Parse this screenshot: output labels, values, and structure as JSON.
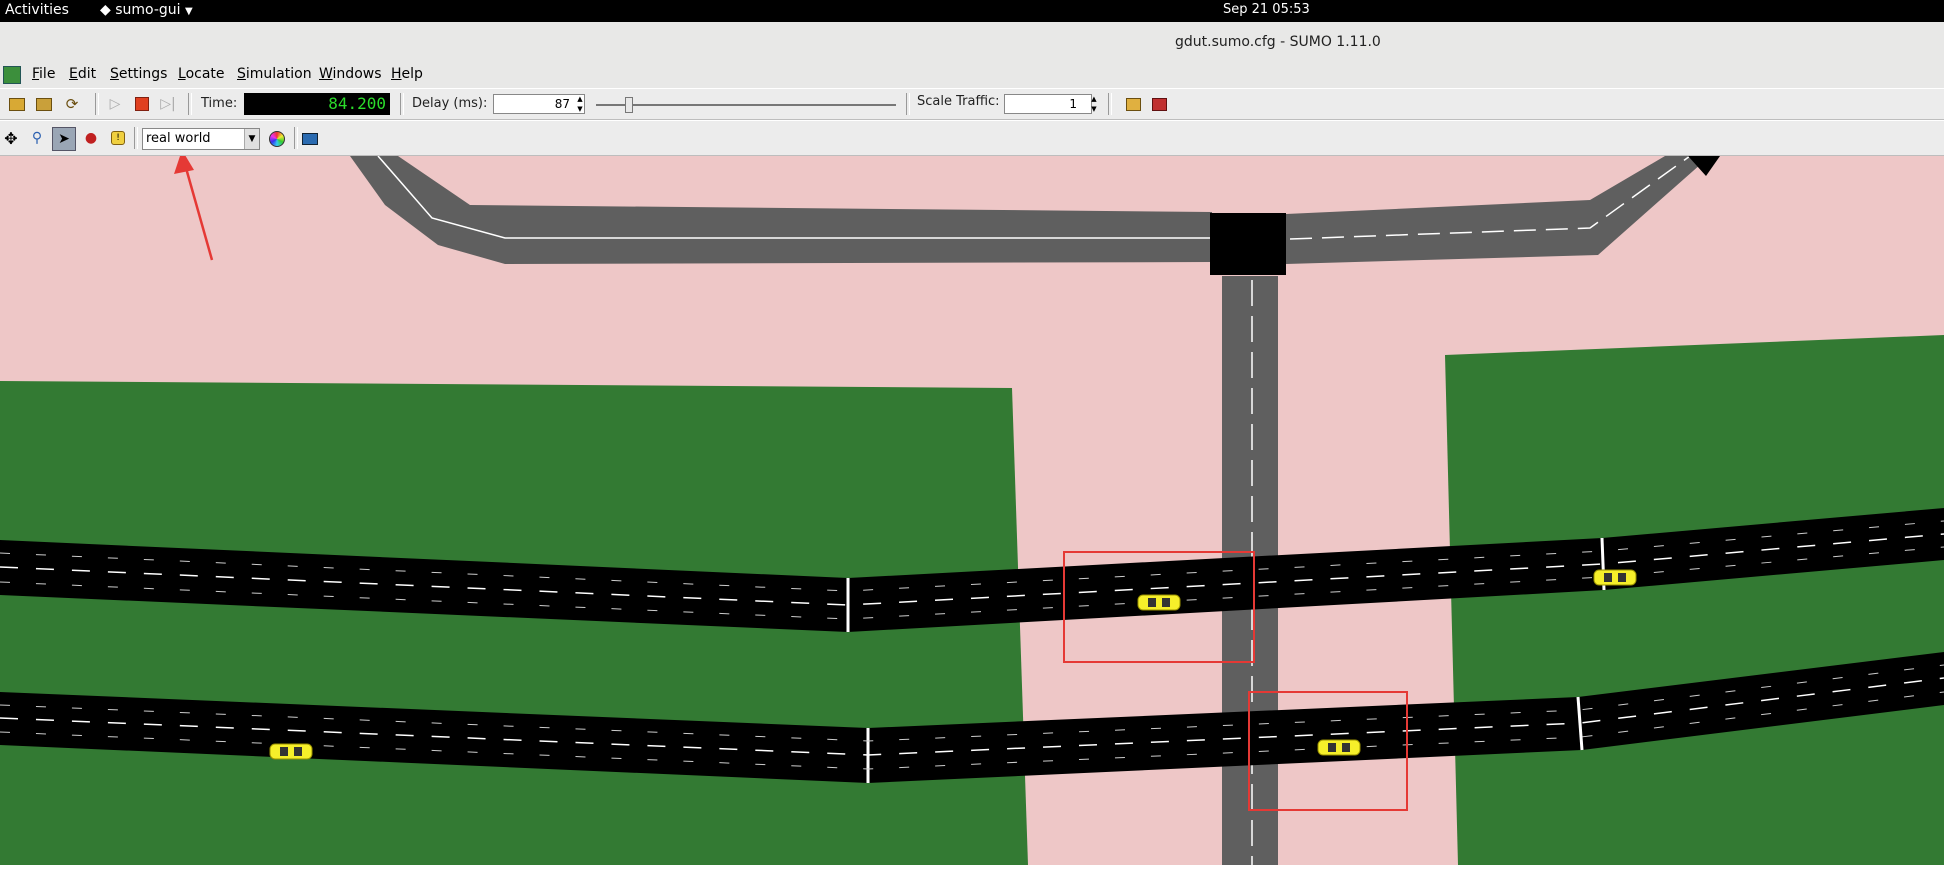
{
  "system": {
    "activities": "Activities",
    "app_menu": "sumo-gui",
    "clock": "Sep 21  05:53"
  },
  "window": {
    "title": "gdut.sumo.cfg - SUMO 1.11.0"
  },
  "menu": {
    "items": [
      "File",
      "Edit",
      "Settings",
      "Locate",
      "Simulation",
      "Windows",
      "Help"
    ]
  },
  "toolbar": {
    "time_label": "Time:",
    "time_value": "84.200",
    "delay_label": "Delay (ms):",
    "delay_value": "87",
    "delay_slider_fraction": 0.1,
    "scale_label": "Scale Traffic:",
    "scale_value": "1"
  },
  "view_toolbar": {
    "scheme_value": "real world"
  },
  "colors": {
    "grass": "#337a33",
    "sidewalk": "#eec7c7",
    "road_gray": "#5f5f5f",
    "road_black": "#000000",
    "vehicle": "#f6ef2a",
    "highlight": "#e53935",
    "clock_digits": "#2bdc2b"
  },
  "icons": {
    "open": "folder-open-icon",
    "reload": "reload-icon",
    "run": "play-icon",
    "stop": "stop-icon",
    "step": "step-icon",
    "recenter": "recenter-icon",
    "locate": "magnifier-icon",
    "select": "select-icon",
    "inspect": "inspect-icon",
    "info": "info-icon",
    "color_wheel": "color-wheel-icon",
    "screenshot": "camera-icon"
  }
}
